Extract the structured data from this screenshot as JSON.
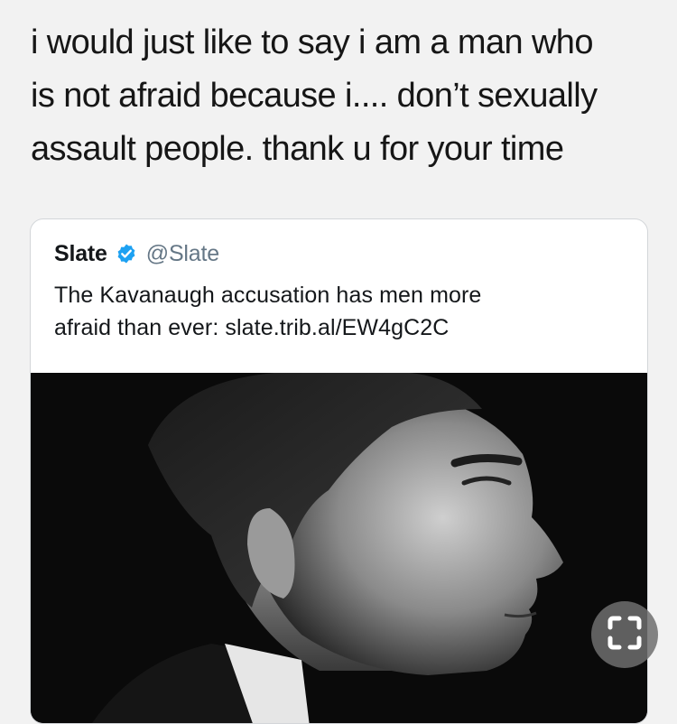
{
  "post": {
    "lines": [
      "i would just like to say i am a man who",
      "is not afraid because i.... don’t sexually",
      "assault people. thank u for your time"
    ]
  },
  "quoted_tweet": {
    "name": "Slate",
    "handle": "@Slate",
    "verified_icon": "verified-badge-icon",
    "verified_color": "#1da1f2",
    "text_lines": [
      "The Kavanaugh accusation has men more",
      "afraid than ever: slate.trib.al/EW4gC2C"
    ],
    "photo": "black-and-white profile portrait of a man"
  },
  "overlay_button": {
    "icon": "expand-icon"
  }
}
